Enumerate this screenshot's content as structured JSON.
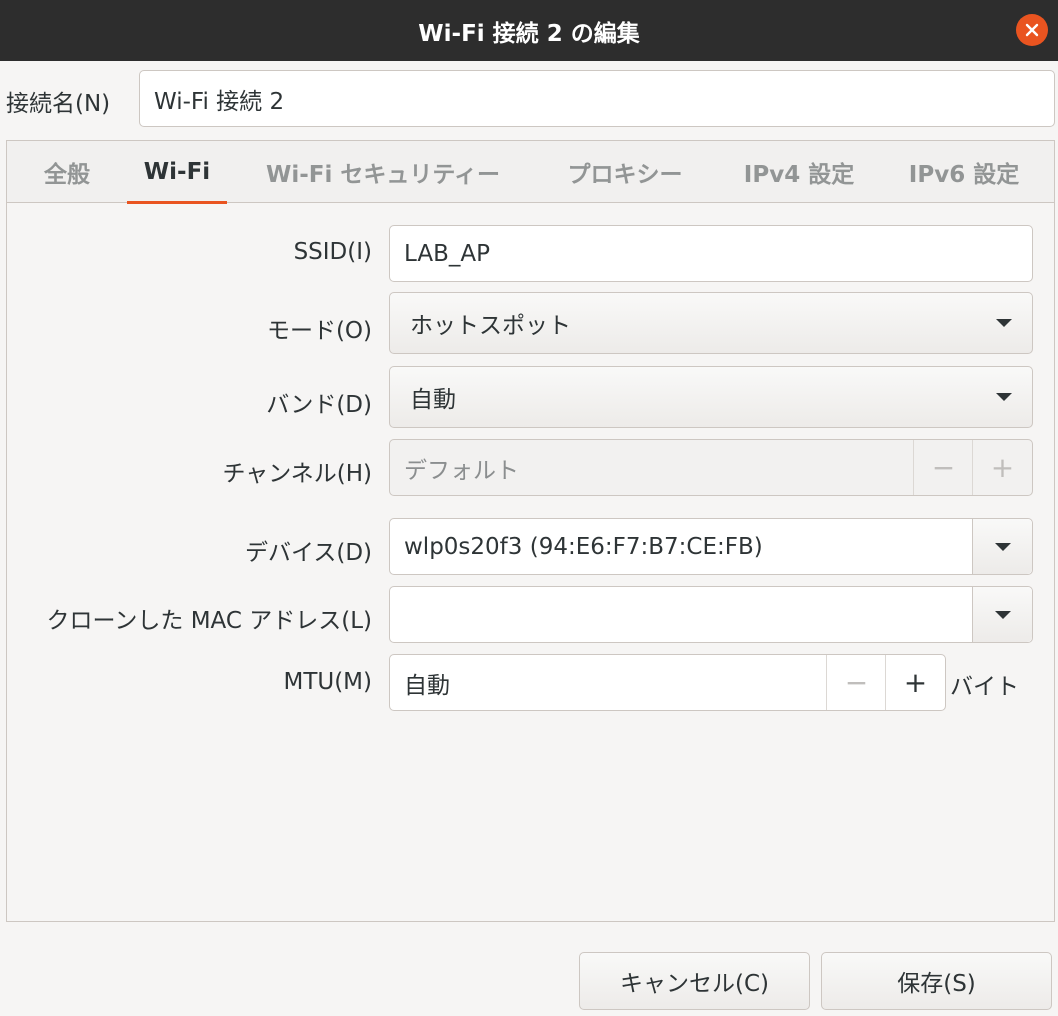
{
  "window": {
    "title": "Wi-Fi 接続 2 の編集",
    "close_icon": "close-icon",
    "close_color": "#e95420"
  },
  "connection": {
    "label": "接続名(N)",
    "value": "Wi-Fi 接続 2"
  },
  "tabs": [
    {
      "label": "全般",
      "active": false
    },
    {
      "label": "Wi-Fi",
      "active": true
    },
    {
      "label": "Wi-Fi セキュリティー",
      "active": false
    },
    {
      "label": "プロキシー",
      "active": false
    },
    {
      "label": "IPv4 設定",
      "active": false
    },
    {
      "label": "IPv6 設定",
      "active": false
    }
  ],
  "form": {
    "ssid": {
      "label": "SSID(I)",
      "value": "LAB_AP"
    },
    "mode": {
      "label": "モード(O)",
      "value": "ホットスポット"
    },
    "band": {
      "label": "バンド(D)",
      "value": "自動"
    },
    "channel": {
      "label": "チャンネル(H)",
      "value": "デフォルト",
      "minus": "−",
      "plus": "+"
    },
    "device": {
      "label": "デバイス(D)",
      "value": "wlp0s20f3 (94:E6:F7:B7:CE:FB)"
    },
    "cloned_mac": {
      "label": "クローンした MAC アドレス(L)",
      "value": ""
    },
    "mtu": {
      "label": "MTU(M)",
      "value": "自動",
      "minus": "−",
      "plus": "+",
      "unit": "バイト"
    }
  },
  "buttons": {
    "cancel": "キャンセル(C)",
    "save": "保存(S)"
  },
  "accent_color": "#e95420"
}
